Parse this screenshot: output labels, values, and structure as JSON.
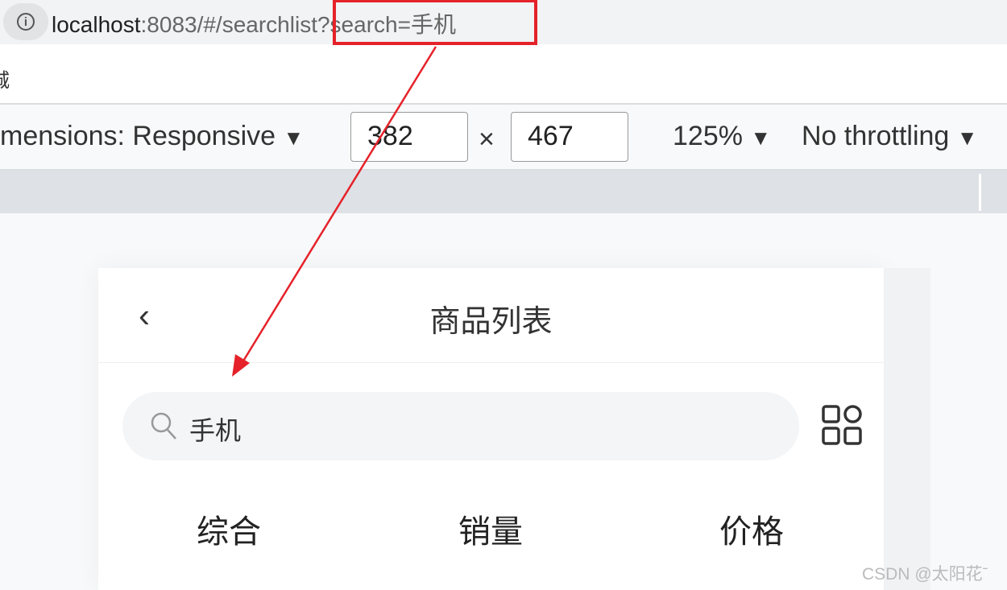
{
  "browser": {
    "url_host": "localhost",
    "url_rest": ":8083/#/searchlist?search=手机",
    "tab_fragment": "城",
    "info_icon": "info-icon"
  },
  "devtools": {
    "dimensions_label": "mensions: Responsive",
    "dropdown_arrow": "▼",
    "width": "382",
    "times": "×",
    "height": "467",
    "zoom": "125%",
    "throttling": "No throttling"
  },
  "page": {
    "back": "‹",
    "title": "商品列表",
    "search_value": "手机",
    "tabs": [
      "综合",
      "销量",
      "价格"
    ]
  },
  "annotation": {
    "color": "#e5222a"
  },
  "watermark": "CSDN @太阳花ˉ"
}
